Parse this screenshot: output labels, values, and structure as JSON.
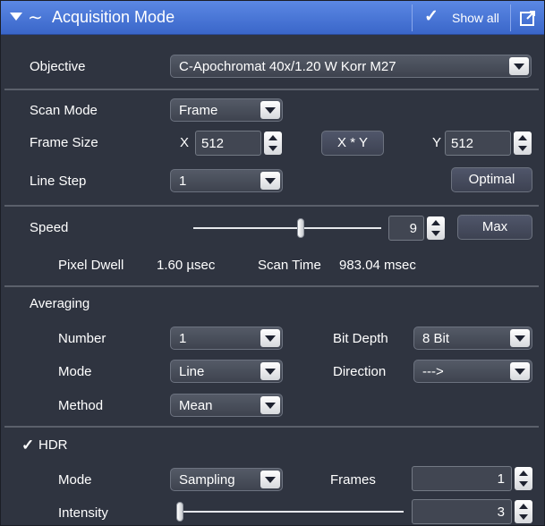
{
  "header": {
    "title": "Acquisition Mode",
    "show_all_label": "Show all",
    "collapse_icon": "triangle-down-icon",
    "mode_icon": "wave-icon",
    "check_icon": "checkmark-icon",
    "popout_icon": "popout-window-icon"
  },
  "objective": {
    "label": "Objective",
    "value": "C-Apochromat 40x/1.20 W Korr M27"
  },
  "scan": {
    "scan_mode_label": "Scan Mode",
    "scan_mode_value": "Frame",
    "frame_size_label": "Frame Size",
    "x_label": "X",
    "x_value": "512",
    "xy_button": "X * Y",
    "y_label": "Y",
    "y_value": "512",
    "line_step_label": "Line Step",
    "line_step_value": "1",
    "optimal_button": "Optimal"
  },
  "speed": {
    "label": "Speed",
    "value": "9",
    "slider_fraction": 0.57,
    "max_button": "Max",
    "pixel_dwell_label": "Pixel Dwell",
    "pixel_dwell_value": "1.60 µsec",
    "scan_time_label": "Scan Time",
    "scan_time_value": "983.04 msec"
  },
  "averaging": {
    "label": "Averaging",
    "number_label": "Number",
    "number_value": "1",
    "bit_depth_label": "Bit Depth",
    "bit_depth_value": "8 Bit",
    "mode_label": "Mode",
    "mode_value": "Line",
    "direction_label": "Direction",
    "direction_value": "--->",
    "method_label": "Method",
    "method_value": "Mean"
  },
  "hdr": {
    "label": "HDR",
    "checked": true,
    "mode_label": "Mode",
    "mode_value": "Sampling",
    "frames_label": "Frames",
    "frames_value": "1",
    "intensity_label": "Intensity",
    "intensity_value": "3",
    "intensity_slider_fraction": 0.0
  },
  "colors": {
    "panel_bg": "#2f3440",
    "header_blue": "#4a76d8",
    "text": "#ffffff"
  }
}
